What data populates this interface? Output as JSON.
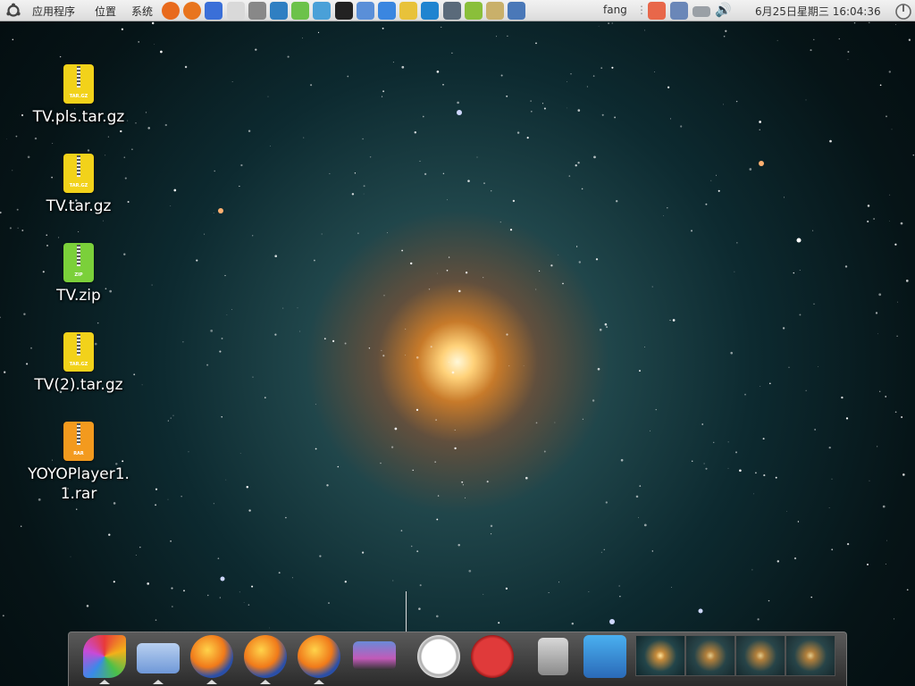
{
  "top_panel": {
    "menus": [
      "应用程序",
      "位置",
      "系统"
    ],
    "launchers": [
      "firefox-icon",
      "firefox-icon",
      "help-icon",
      "printer-icon",
      "settings-icon",
      "nvu-icon",
      "office-icon",
      "editor-icon",
      "terminal-icon",
      "itunes-icon",
      "chat-icon",
      "photo-icon",
      "network-icon",
      "keyboard-icon",
      "notes-icon",
      "image-viewer-icon",
      "x-icon"
    ],
    "user": "fang",
    "datetime": "6月25日星期三  16:04:36"
  },
  "desktop": {
    "icons": [
      {
        "label": "TV.pls.tar.gz",
        "type": "tar-archive",
        "tag": "TAR.GZ",
        "color": "#f2d21a"
      },
      {
        "label": "TV.tar.gz",
        "type": "tar-archive",
        "tag": "TAR.GZ",
        "color": "#f2d21a"
      },
      {
        "label": "TV.zip",
        "type": "zip-archive",
        "tag": "ZIP",
        "color": "#7bd03a"
      },
      {
        "label": "TV(2).tar.gz",
        "type": "tar-archive",
        "tag": "TAR.GZ",
        "color": "#f2d21a"
      },
      {
        "label": "YOYOPlayer1.\n1.rar",
        "type": "rar-archive",
        "tag": "RAR",
        "color": "#f39a1e"
      }
    ]
  },
  "dock": {
    "items": [
      "app-launcher-icon",
      "home-folder-icon",
      "firefox-icon",
      "firefox-icon",
      "firefox-icon",
      "desktop-preview-icon",
      "clock-icon",
      "lastfm-icon",
      "trash-icon",
      "network-computer-icon"
    ],
    "workspace_count": 4
  }
}
